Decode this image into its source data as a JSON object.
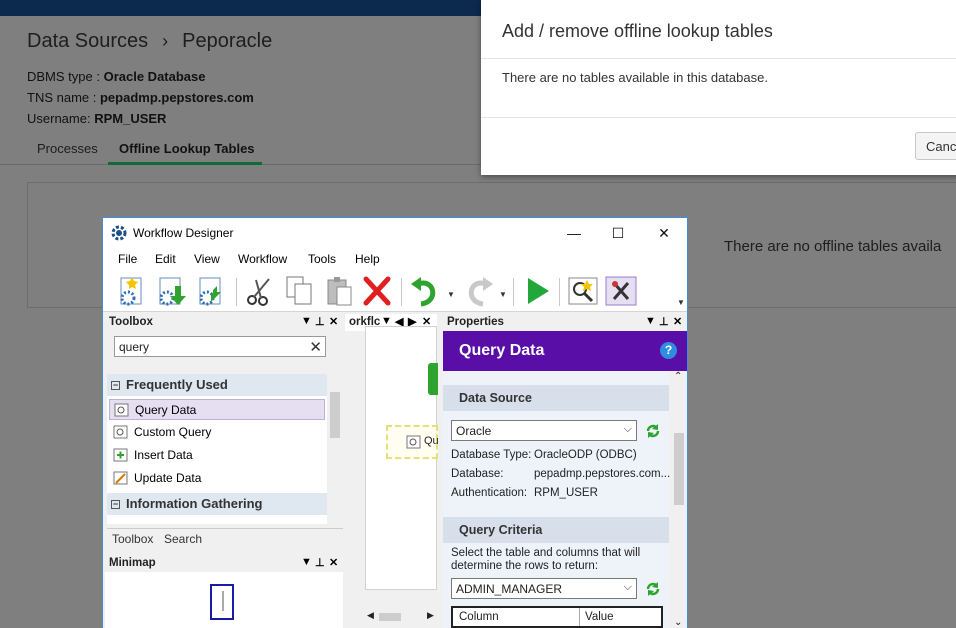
{
  "page": {
    "breadcrumb": {
      "root": "Data Sources",
      "separator": "›",
      "current": "Peporacle"
    },
    "meta": {
      "dbms_label": "DBMS type :",
      "dbms_value": "Oracle Database",
      "tns_label": "TNS name :",
      "tns_value": "pepadmp.pepstores.com",
      "user_label": "Username:",
      "user_value": "RPM_USER"
    },
    "tabs": [
      "Processes",
      "Offline Lookup Tables"
    ],
    "active_tab": "Offline Lookup Tables",
    "empty_message": "There are no offline tables availa"
  },
  "modal": {
    "title": "Add / remove offline lookup tables",
    "body": "There are no tables available in this database.",
    "cancel_label": "Canc"
  },
  "workflow_designer": {
    "title": "Workflow Designer",
    "window_controls": {
      "minimize": "—",
      "maximize": "☐",
      "close": "✕"
    },
    "menu": [
      "File",
      "Edit",
      "View",
      "Workflow",
      "Tools",
      "Help"
    ],
    "toolbox": {
      "header": "Toolbox",
      "search_value": "query",
      "categories": [
        {
          "name": "Frequently Used",
          "toggle": "−"
        },
        {
          "name": "Information Gathering",
          "toggle": "−"
        }
      ],
      "items": [
        "Query Data",
        "Custom Query",
        "Insert Data",
        "Update Data"
      ],
      "selected_item": "Query Data",
      "bottom_tabs": [
        "Toolbox",
        "Search"
      ]
    },
    "minimap": {
      "header": "Minimap"
    },
    "canvas": {
      "tab_label": "orkflc",
      "node_label": "Qu"
    },
    "properties": {
      "header": "Properties",
      "banner": "Query Data",
      "help": "?",
      "data_source": {
        "heading": "Data Source",
        "selected": "Oracle",
        "rows": [
          {
            "key": "Database Type:",
            "value": "OracleODP (ODBC)"
          },
          {
            "key": "Database:",
            "value": "pepadmp.pepstores.com..."
          },
          {
            "key": "Authentication:",
            "value": "RPM_USER"
          }
        ]
      },
      "query_criteria": {
        "heading": "Query Criteria",
        "hint": "Select the table and columns that will determine the rows to return:",
        "table_selected": "ADMIN_MANAGER",
        "grid_headers": [
          "Column",
          "Value"
        ]
      }
    }
  },
  "colors": {
    "accent_purple": "#5a0ea8",
    "tab_underline_green": "#0e6b3a",
    "topbar_navy": "#0b2a4e",
    "window_border_blue": "#3c8fd8"
  }
}
